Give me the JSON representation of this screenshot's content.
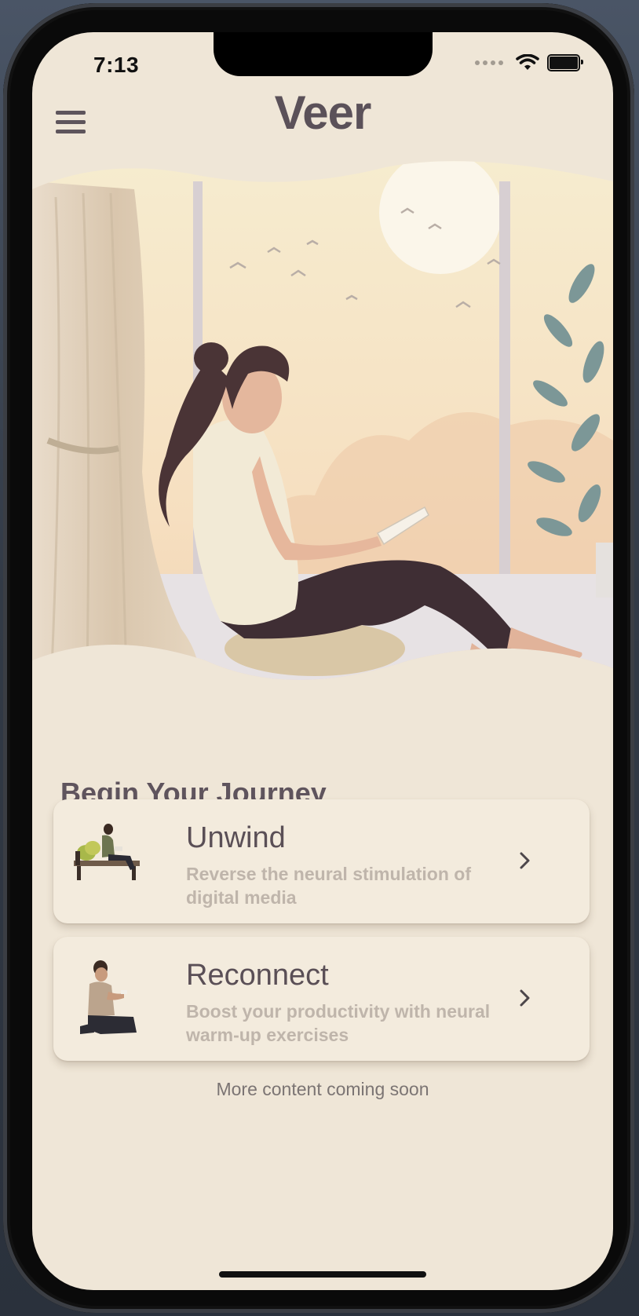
{
  "status_bar": {
    "time": "7:13"
  },
  "header": {
    "title": "Veer",
    "menu_icon": "hamburger-menu-icon"
  },
  "hero": {
    "illustration": "woman-reading-by-window-illustration"
  },
  "section": {
    "title": "Begin Your Journey"
  },
  "cards": [
    {
      "title": "Unwind",
      "description": "Reverse the neural stimulation of digital media",
      "icon": "man-on-bench-illustration"
    },
    {
      "title": "Reconnect",
      "description": "Boost your productivity with neural warm-up exercises",
      "icon": "man-sitting-with-phone-illustration"
    }
  ],
  "footer": {
    "note": "More content coming soon"
  },
  "colors": {
    "background": "#efe6d7",
    "title": "#5b5159",
    "card": "#f3ebdd",
    "muted": "#bfb5ab"
  }
}
